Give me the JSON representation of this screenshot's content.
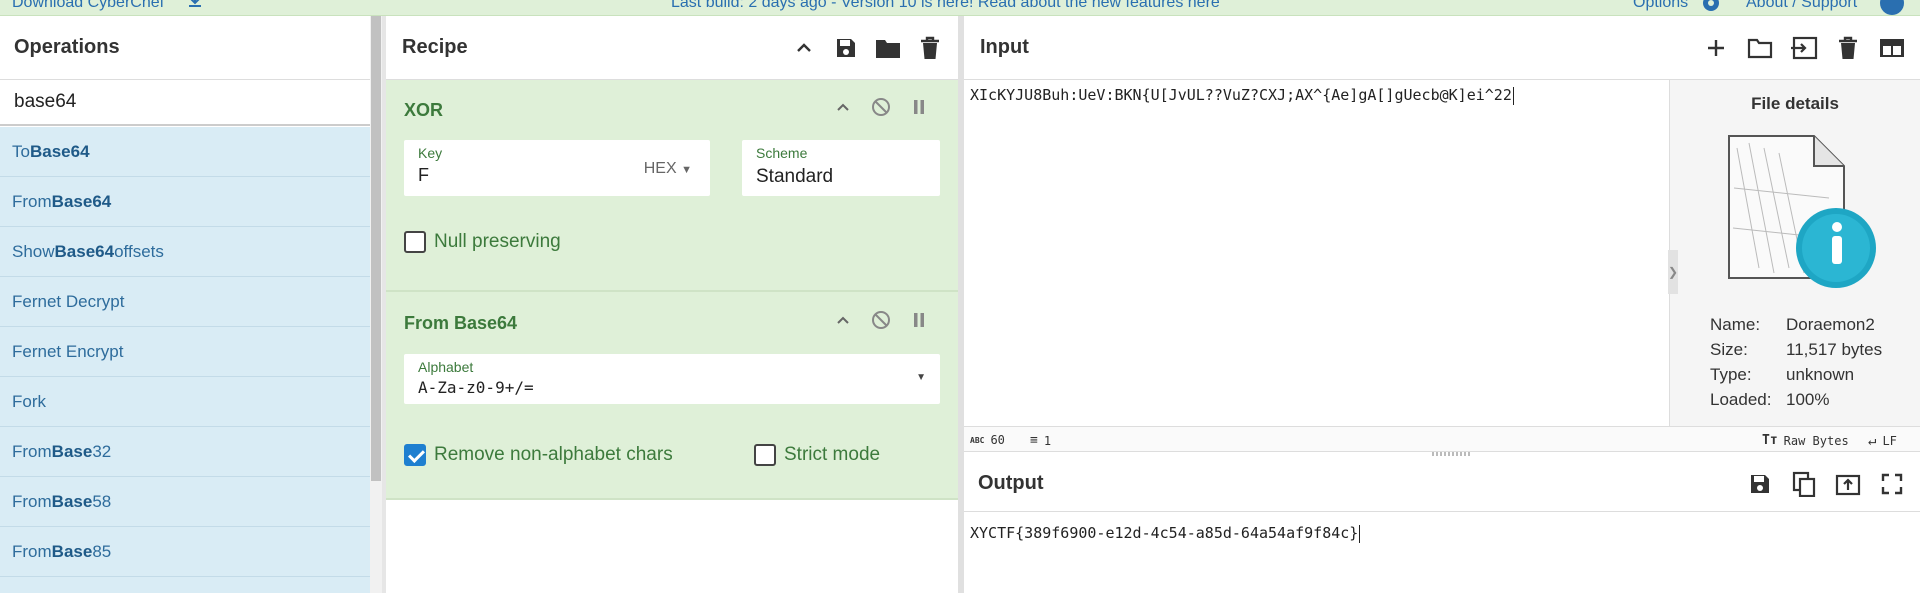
{
  "banner": {
    "download_label": "Download CyberChef",
    "build_notice": "Last build: 2 days ago - Version 10 is here! Read about the new features here",
    "options_label": "Options",
    "about_label": "About / Support"
  },
  "operations": {
    "title": "Operations",
    "search_value": "base64",
    "items": [
      {
        "pre": "To ",
        "bold": "Base64",
        "post": ""
      },
      {
        "pre": "From ",
        "bold": "Base64",
        "post": ""
      },
      {
        "pre": "Show ",
        "bold": "Base64",
        "post": " offsets"
      },
      {
        "pre": "Fernet Decrypt",
        "bold": "",
        "post": ""
      },
      {
        "pre": "Fernet Encrypt",
        "bold": "",
        "post": ""
      },
      {
        "pre": "Fork",
        "bold": "",
        "post": ""
      },
      {
        "pre": "From ",
        "bold": "Base",
        "post": "32"
      },
      {
        "pre": "From ",
        "bold": "Base",
        "post": "58"
      },
      {
        "pre": "From ",
        "bold": "Base",
        "post": "85"
      }
    ]
  },
  "recipe": {
    "title": "Recipe",
    "xor": {
      "title": "XOR",
      "key_label": "Key",
      "key_value": "F",
      "key_format": "HEX",
      "scheme_label": "Scheme",
      "scheme_value": "Standard",
      "null_preserving_label": "Null preserving",
      "null_preserving_checked": false
    },
    "from_base64": {
      "title": "From Base64",
      "alphabet_label": "Alphabet",
      "alphabet_value": "A-Za-z0-9+/=",
      "remove_non_alpha_label": "Remove non-alphabet chars",
      "remove_non_alpha_checked": true,
      "strict_mode_label": "Strict mode",
      "strict_mode_checked": false
    }
  },
  "input": {
    "title": "Input",
    "text": "XIcKYJU8Buh:UeV:BKN{U[JvUL??VuZ?CXJ;AX^{Ae]gA[]gUecb@K]ei^22",
    "char_count": "60",
    "line_count": "1",
    "encoding": "Raw Bytes",
    "eol": "LF"
  },
  "file_details": {
    "title": "File details",
    "name_label": "Name:",
    "name_value": "Doraemon2",
    "size_label": "Size:",
    "size_value": "11,517 bytes",
    "type_label": "Type:",
    "type_value": "unknown",
    "loaded_label": "Loaded:",
    "loaded_value": "100%"
  },
  "output": {
    "title": "Output",
    "text": "XYCTF{389f6900-e12d-4c54-a85d-64a54af9f84c}"
  },
  "colors": {
    "operation_bg": "#dff0d8",
    "ops_list_bg": "#d9ecf5",
    "accent_green": "#3c7a3c",
    "link_blue": "#2a6fb0",
    "checkbox_blue": "#1e7fd0"
  }
}
